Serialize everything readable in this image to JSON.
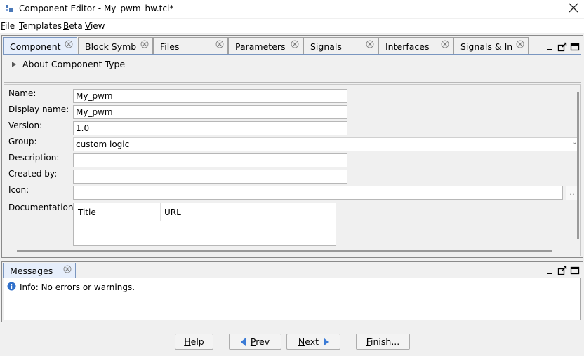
{
  "window": {
    "title": "Component Editor - My_pwm_hw.tcl*"
  },
  "menu": {
    "items": [
      {
        "mnemonic": "F",
        "rest": "ile"
      },
      {
        "mnemonic": "T",
        "rest": "emplates"
      },
      {
        "mnemonic": "B",
        "rest": "eta"
      },
      {
        "mnemonic": "V",
        "rest": "iew"
      }
    ]
  },
  "tabs": [
    {
      "label": "Component",
      "active": true
    },
    {
      "label": "Block Symb",
      "active": false
    },
    {
      "label": "Files",
      "active": false
    },
    {
      "label": "Parameters",
      "active": false
    },
    {
      "label": "Signals",
      "active": false
    },
    {
      "label": "Interfaces",
      "active": false
    },
    {
      "label": "Signals & In",
      "active": false
    }
  ],
  "about": {
    "label": "About Component Type"
  },
  "form": {
    "name_label": "Name:",
    "name_value": "My_pwm",
    "display_label": "Display name:",
    "display_value": "My_pwm",
    "version_label": "Version:",
    "version_value": "1.0",
    "group_label": "Group:",
    "group_value": "custom logic",
    "description_label": "Description:",
    "description_value": "",
    "created_label": "Created by:",
    "created_value": "",
    "icon_label": "Icon:",
    "icon_value": "",
    "icon_browse": "..",
    "doc_label": "Documentation:",
    "doc_columns": [
      "Title",
      "URL"
    ]
  },
  "messages": {
    "tab_label": "Messages",
    "text": "Info: No errors or warnings."
  },
  "buttons": {
    "help": {
      "mnemonic": "H",
      "rest": "elp"
    },
    "prev": {
      "mnemonic": "P",
      "rest": "rev"
    },
    "next": {
      "mnemonic": "N",
      "rest": "ext"
    },
    "finish": {
      "mnemonic": "F",
      "rest": "inish..."
    }
  },
  "colors": {
    "tab_active": "#e6eefb",
    "accent": "#3b7bd6",
    "info": "#2f6fca"
  }
}
